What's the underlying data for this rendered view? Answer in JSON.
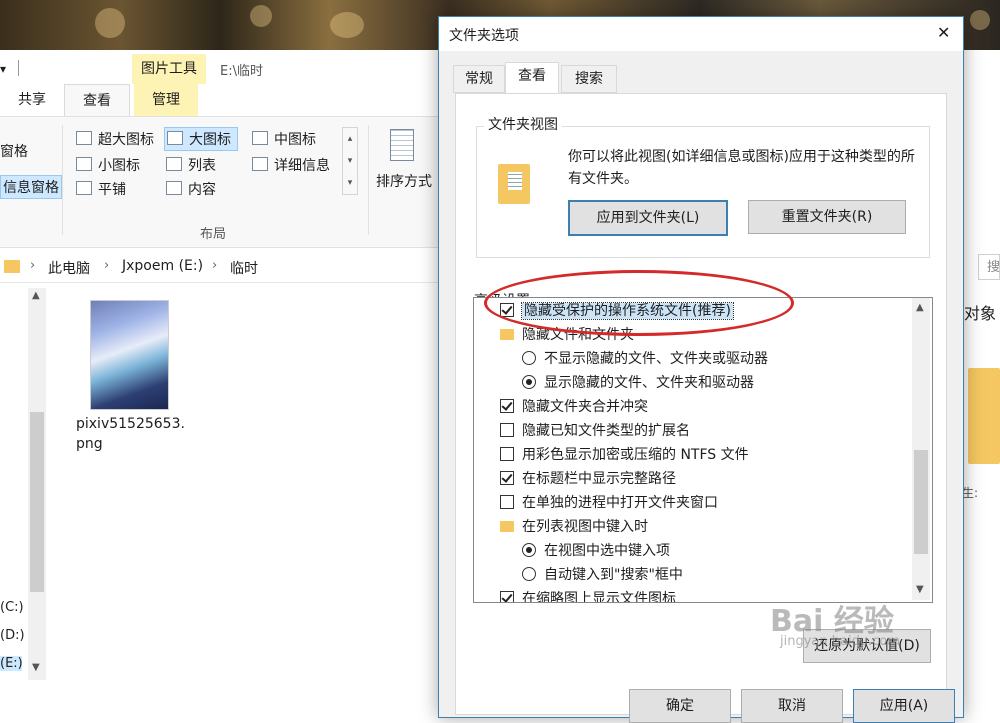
{
  "explorer": {
    "quick_access_arrow": "▾",
    "context_tab": "图片工具",
    "window_path": "E:\\临时",
    "tabs": [
      "共享",
      "查看",
      "管理"
    ],
    "panes": [
      "窗格",
      "信息窗格"
    ],
    "layout": {
      "items": [
        "超大图标",
        "大图标",
        "中图标",
        "小图标",
        "列表",
        "详细信息",
        "平铺",
        "内容"
      ],
      "group_label": "布局"
    },
    "sort_label": "排序方式",
    "address": {
      "crumbs": [
        "此电脑",
        "Jxpoem (E:)",
        "临时"
      ],
      "sep": "›"
    },
    "search_placeholder": "搜",
    "drives": [
      "(C:)",
      "(D:)",
      "(E:)"
    ],
    "file_name": "pixiv51525653.png",
    "right_partial": "对象",
    "right_partial2": "生:"
  },
  "dialog": {
    "title": "文件夹选项",
    "close": "✕",
    "tabs": [
      "常规",
      "查看",
      "搜索"
    ],
    "active_tab": "查看",
    "folder_views": {
      "legend": "文件夹视图",
      "desc": "你可以将此视图(如详细信息或图标)应用于这种类型的所有文件夹。",
      "apply_button": "应用到文件夹(L)",
      "reset_button": "重置文件夹(R)"
    },
    "advanced_label": "高级设置:",
    "settings": [
      {
        "type": "checkbox",
        "checked": true,
        "label": "隐藏受保护的操作系统文件(推荐)",
        "selected": true
      },
      {
        "type": "folder",
        "label": "隐藏文件和文件夹"
      },
      {
        "type": "radio",
        "checked": false,
        "label": "不显示隐藏的文件、文件夹或驱动器"
      },
      {
        "type": "radio",
        "checked": true,
        "label": "显示隐藏的文件、文件夹和驱动器"
      },
      {
        "type": "checkbox",
        "checked": true,
        "label": "隐藏文件夹合并冲突"
      },
      {
        "type": "checkbox",
        "checked": false,
        "label": "隐藏已知文件类型的扩展名"
      },
      {
        "type": "checkbox",
        "checked": false,
        "label": "用彩色显示加密或压缩的 NTFS 文件"
      },
      {
        "type": "checkbox",
        "checked": true,
        "label": "在标题栏中显示完整路径"
      },
      {
        "type": "checkbox",
        "checked": false,
        "label": "在单独的进程中打开文件夹窗口"
      },
      {
        "type": "folder",
        "label": "在列表视图中键入时"
      },
      {
        "type": "radio",
        "checked": true,
        "label": "在视图中选中键入项"
      },
      {
        "type": "radio",
        "checked": false,
        "label": "自动键入到\"搜索\"框中"
      },
      {
        "type": "checkbox",
        "checked": true,
        "label": "在缩略图上显示文件图标"
      }
    ],
    "restore_defaults": "还原为默认值(D)",
    "footer_buttons": [
      "确定",
      "取消",
      "应用(A)"
    ]
  },
  "watermark": {
    "brand": "Bai 经验",
    "url": "jingyan.baidu.com"
  },
  "colors": {
    "highlight_oval": "#d42a2a",
    "accent": "#0078d7",
    "folder": "#f4c762"
  }
}
